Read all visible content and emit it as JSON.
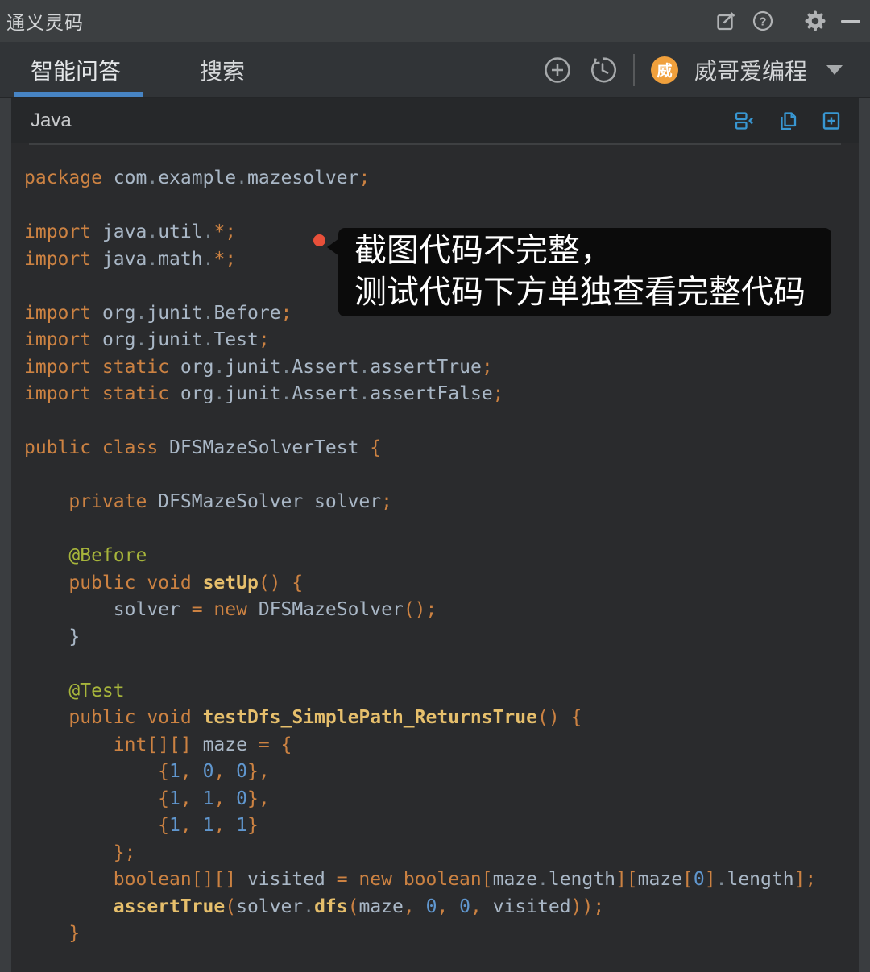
{
  "titlebar": {
    "title": "通义灵码",
    "help_glyph": "?"
  },
  "tabbar": {
    "tabs": [
      {
        "label": "智能问答",
        "active": true
      },
      {
        "label": "搜索",
        "active": false
      }
    ],
    "user": {
      "avatar_text": "威",
      "name": "威哥爱编程"
    }
  },
  "code_panel": {
    "language": "Java"
  },
  "tooltip": {
    "lines": [
      "截图代码不完整，",
      "测试代码下方单独查看完整代码"
    ]
  },
  "colors": {
    "titlebar_bg": "#3c3f41",
    "tabbar_bg": "#313437",
    "panel_margin_bg": "#3a3d40",
    "code_header_bg": "#26282a",
    "code_body_bg": "#2a2b2d",
    "accent_blue_icons": "#3897d2",
    "tab_underline": "#4784c4",
    "avatar_orange": "#f0a03c",
    "alert_dot_red": "#e8503a",
    "syntax_keyword": "#cc8242",
    "syntax_plain": "#a9b7c6",
    "syntax_dot": "#7e8a94",
    "syntax_function": "#e6bf6c",
    "syntax_annotation": "#a7b53b",
    "syntax_number": "#6097cf",
    "tooltip_bg": "#0b0b0b"
  },
  "code": {
    "lines": [
      [
        [
          "k",
          "package "
        ],
        [
          "p",
          "com"
        ],
        [
          "d",
          "."
        ],
        [
          "p",
          "example"
        ],
        [
          "d",
          "."
        ],
        [
          "p",
          "mazesolver"
        ],
        [
          "k",
          ";"
        ]
      ],
      [],
      [
        [
          "k",
          "import "
        ],
        [
          "p",
          "java"
        ],
        [
          "d",
          "."
        ],
        [
          "p",
          "util"
        ],
        [
          "d",
          "."
        ],
        [
          "k",
          "*;"
        ]
      ],
      [
        [
          "k",
          "import "
        ],
        [
          "p",
          "java"
        ],
        [
          "d",
          "."
        ],
        [
          "p",
          "math"
        ],
        [
          "d",
          "."
        ],
        [
          "k",
          "*;"
        ]
      ],
      [],
      [
        [
          "k",
          "import "
        ],
        [
          "p",
          "org"
        ],
        [
          "d",
          "."
        ],
        [
          "p",
          "junit"
        ],
        [
          "d",
          "."
        ],
        [
          "p",
          "Before"
        ],
        [
          "k",
          ";"
        ]
      ],
      [
        [
          "k",
          "import "
        ],
        [
          "p",
          "org"
        ],
        [
          "d",
          "."
        ],
        [
          "p",
          "junit"
        ],
        [
          "d",
          "."
        ],
        [
          "p",
          "Test"
        ],
        [
          "k",
          ";"
        ]
      ],
      [
        [
          "k",
          "import static "
        ],
        [
          "p",
          "org"
        ],
        [
          "d",
          "."
        ],
        [
          "p",
          "junit"
        ],
        [
          "d",
          "."
        ],
        [
          "p",
          "Assert"
        ],
        [
          "d",
          "."
        ],
        [
          "p",
          "assertTrue"
        ],
        [
          "k",
          ";"
        ]
      ],
      [
        [
          "k",
          "import static "
        ],
        [
          "p",
          "org"
        ],
        [
          "d",
          "."
        ],
        [
          "p",
          "junit"
        ],
        [
          "d",
          "."
        ],
        [
          "p",
          "Assert"
        ],
        [
          "d",
          "."
        ],
        [
          "p",
          "assertFalse"
        ],
        [
          "k",
          ";"
        ]
      ],
      [],
      [
        [
          "k",
          "public class "
        ],
        [
          "p",
          "DFSMazeSolverTest "
        ],
        [
          "k",
          "{"
        ]
      ],
      [],
      [
        [
          "k",
          "    private "
        ],
        [
          "p",
          "DFSMazeSolver solver"
        ],
        [
          "k",
          ";"
        ]
      ],
      [],
      [
        [
          "a",
          "    @Before"
        ]
      ],
      [
        [
          "k",
          "    public void "
        ],
        [
          "f",
          "setUp"
        ],
        [
          "k",
          "() {"
        ]
      ],
      [
        [
          "p",
          "        solver "
        ],
        [
          "k",
          "= new "
        ],
        [
          "p",
          "DFSMazeSolver"
        ],
        [
          "k",
          "();"
        ]
      ],
      [
        [
          "p",
          "    }"
        ]
      ],
      [],
      [
        [
          "a",
          "    @Test"
        ]
      ],
      [
        [
          "k",
          "    public void "
        ],
        [
          "f",
          "testDfs_SimplePath_ReturnsTrue"
        ],
        [
          "k",
          "() {"
        ]
      ],
      [
        [
          "k",
          "        int[][] "
        ],
        [
          "p",
          "maze "
        ],
        [
          "k",
          "= {"
        ]
      ],
      [
        [
          "k",
          "            {"
        ],
        [
          "n",
          "1"
        ],
        [
          "k",
          ", "
        ],
        [
          "n",
          "0"
        ],
        [
          "k",
          ", "
        ],
        [
          "n",
          "0"
        ],
        [
          "k",
          "},"
        ]
      ],
      [
        [
          "k",
          "            {"
        ],
        [
          "n",
          "1"
        ],
        [
          "k",
          ", "
        ],
        [
          "n",
          "1"
        ],
        [
          "k",
          ", "
        ],
        [
          "n",
          "0"
        ],
        [
          "k",
          "},"
        ]
      ],
      [
        [
          "k",
          "            {"
        ],
        [
          "n",
          "1"
        ],
        [
          "k",
          ", "
        ],
        [
          "n",
          "1"
        ],
        [
          "k",
          ", "
        ],
        [
          "n",
          "1"
        ],
        [
          "k",
          "}"
        ]
      ],
      [
        [
          "k",
          "        };"
        ]
      ],
      [
        [
          "k",
          "        boolean[][] "
        ],
        [
          "p",
          "visited "
        ],
        [
          "k",
          "= new boolean["
        ],
        [
          "p",
          "maze"
        ],
        [
          "d",
          "."
        ],
        [
          "p",
          "length"
        ],
        [
          "k",
          "]["
        ],
        [
          "p",
          "maze"
        ],
        [
          "k",
          "["
        ],
        [
          "n",
          "0"
        ],
        [
          "k",
          "]"
        ],
        [
          "d",
          "."
        ],
        [
          "p",
          "length"
        ],
        [
          "k",
          "];"
        ]
      ],
      [
        [
          "f",
          "        assertTrue"
        ],
        [
          "k",
          "("
        ],
        [
          "p",
          "solver"
        ],
        [
          "d",
          "."
        ],
        [
          "f",
          "dfs"
        ],
        [
          "k",
          "("
        ],
        [
          "p",
          "maze"
        ],
        [
          "k",
          ", "
        ],
        [
          "n",
          "0"
        ],
        [
          "k",
          ", "
        ],
        [
          "n",
          "0"
        ],
        [
          "k",
          ", "
        ],
        [
          "p",
          "visited"
        ],
        [
          "k",
          "));"
        ]
      ],
      [
        [
          "k",
          "    }"
        ]
      ]
    ]
  }
}
